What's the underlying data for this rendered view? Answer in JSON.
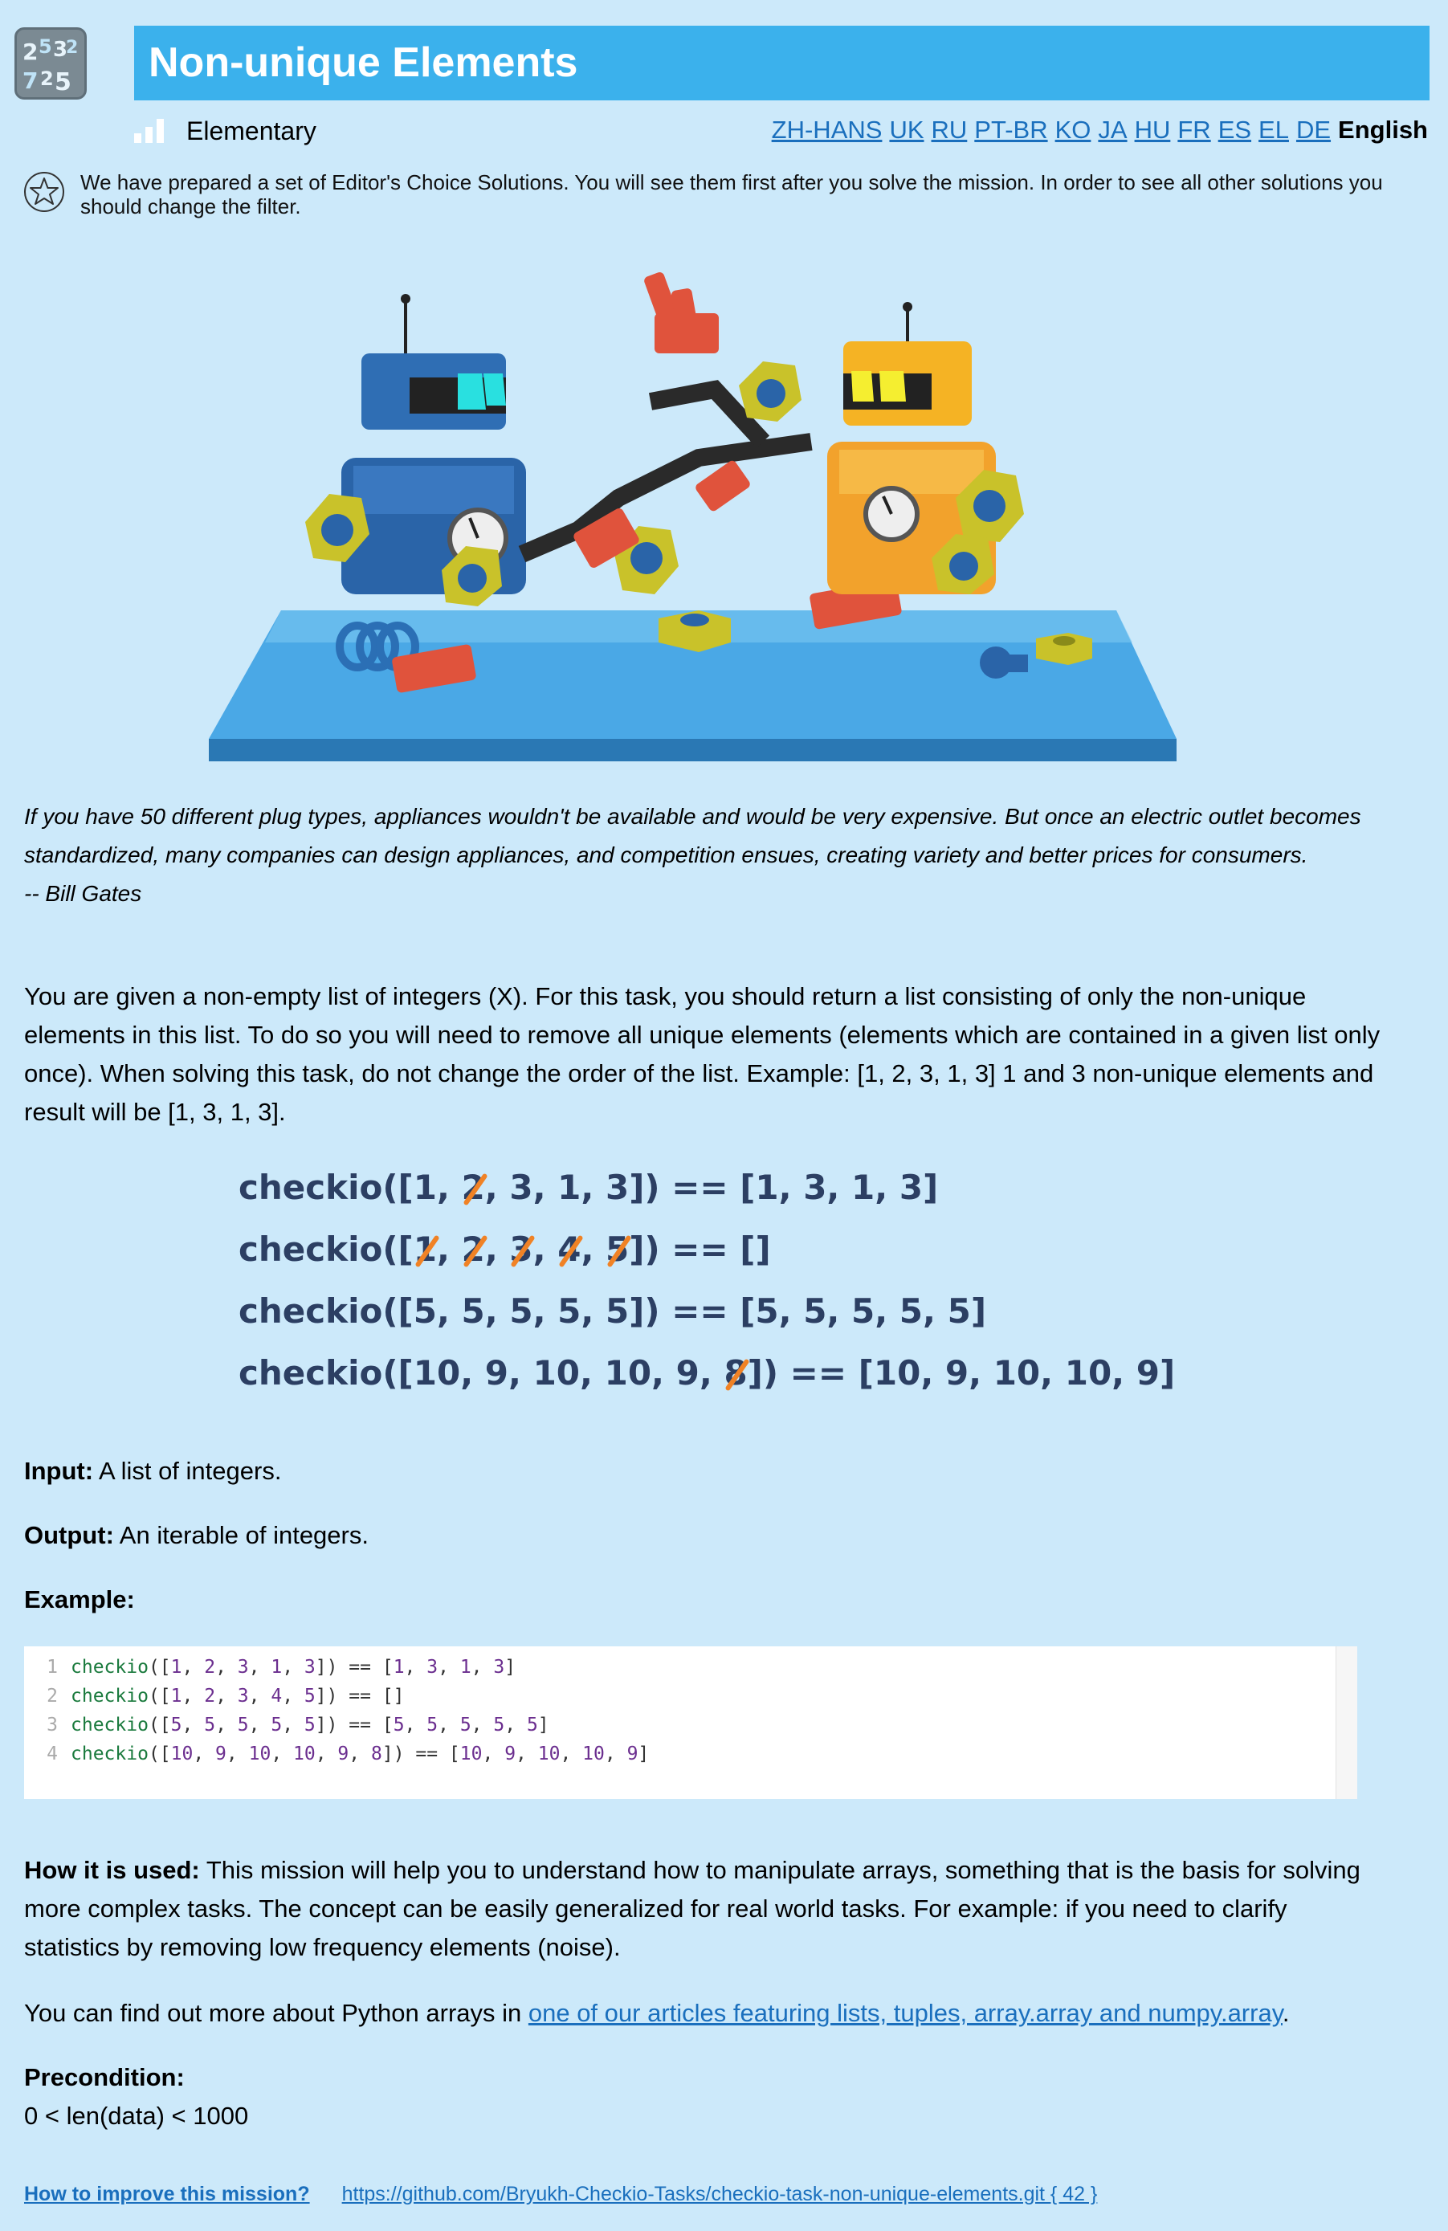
{
  "header": {
    "title": "Non-unique Elements",
    "difficulty": "Elementary",
    "difficulty_level": 2,
    "logo_digits": "25 32 72 5"
  },
  "languages": {
    "links": [
      "ZH-HANS",
      "UK",
      "RU",
      "PT-BR",
      "KO",
      "JA",
      "HU",
      "FR",
      "ES",
      "EL",
      "DE"
    ],
    "current": "English"
  },
  "editor_note": "We have prepared a set of Editor's Choice Solutions. You will see them first after you solve the mission. In order to see all other solutions you should change the filter.",
  "quote": {
    "text": "If you have 50 different plug types, appliances wouldn't be available and would be very expensive. But once an electric outlet becomes standardized, many companies can design appliances, and competition ensues, creating variety and better prices for consumers.",
    "author": "-- Bill Gates"
  },
  "description": "You are given a non-empty list of integers (X). For this task, you should return a list consisting of only the non-unique elements in this list. To do so you will need to remove all unique elements (elements which are contained in a given list only once). When solving this task, do not change the order of the list. Example: [1, 2, 3, 1, 3] 1 and 3 non-unique elements and result will be [1, 3, 1, 3].",
  "input": {
    "label": "Input:",
    "text": "A list of integers."
  },
  "output": {
    "label": "Output:",
    "text": "An iterable of integers."
  },
  "example_label": "Example:",
  "code": [
    "checkio([1, 2, 3, 1, 3]) == [1, 3, 1, 3]",
    "checkio([1, 2, 3, 4, 5]) == []",
    "checkio([5, 5, 5, 5, 5]) == [5, 5, 5, 5, 5]",
    "checkio([10, 9, 10, 10, 9, 8]) == [10, 9, 10, 10, 9]"
  ],
  "how_used": {
    "label": "How it is used:",
    "text": "This mission will help you to understand how to manipulate arrays, something that is the basis for solving more complex tasks. The concept can be easily generalized for real world tasks. For example: if you need to clarify statistics by removing low frequency elements (noise)."
  },
  "arrays": {
    "prefix": "You can find out more about Python arrays in ",
    "link": "one of our articles featuring lists, tuples, array.array and numpy.array",
    "suffix": "."
  },
  "precondition": {
    "label": "Precondition:",
    "text": "0 < len(data) < 1000"
  },
  "footer": {
    "improve": "How to improve this mission?",
    "repo": "https://github.com/Bryukh-Checkio-Tasks/checkio-task-non-unique-elements.git { 42 }"
  },
  "colors": {
    "background": "#cce9fa",
    "title_bar": "#3bb1ec",
    "link": "#1a6fbd",
    "strike": "#f08225",
    "example_text": "#2c3f63"
  }
}
